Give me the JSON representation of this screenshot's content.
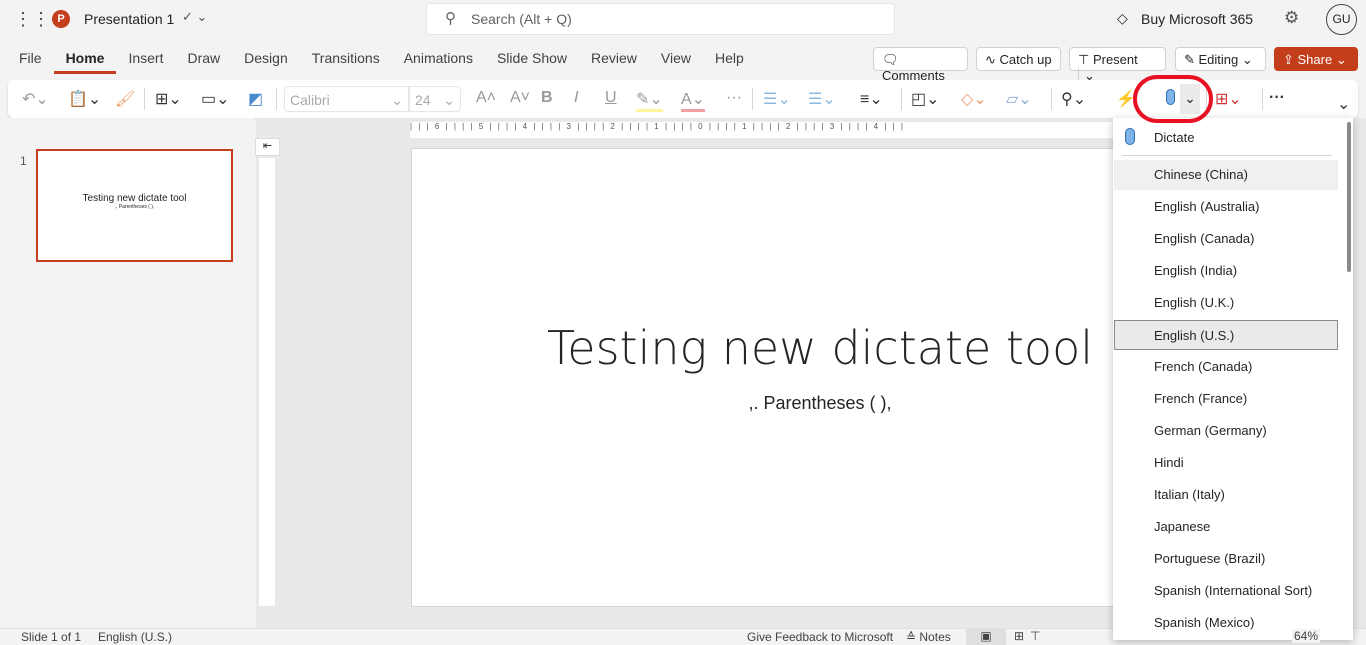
{
  "titlebar": {
    "app_title": "Presentation 1",
    "search_placeholder": "Search (Alt + Q)",
    "buy": "Buy Microsoft 365",
    "avatar": "GU"
  },
  "tabs": [
    {
      "label": "File"
    },
    {
      "label": "Home"
    },
    {
      "label": "Insert"
    },
    {
      "label": "Draw"
    },
    {
      "label": "Design"
    },
    {
      "label": "Transitions"
    },
    {
      "label": "Animations"
    },
    {
      "label": "Slide Show"
    },
    {
      "label": "Review"
    },
    {
      "label": "View"
    },
    {
      "label": "Help"
    }
  ],
  "actions": {
    "comments": "Comments",
    "catchup": "Catch up",
    "present": "Present",
    "editing": "Editing",
    "share": "Share"
  },
  "ribbon": {
    "font": "Calibri",
    "size": "24"
  },
  "ruler": {
    "h": "| | | 6 | | | | 5 | | | | 4 | | | | 3 | | | | 2 | | | | 1 | | | | 0 | | | | 1 | | | | 2 | | | | 3 | | | | 4 | | |"
  },
  "thumbnail": {
    "number": "1",
    "title": "Testing new dictate tool",
    "subtitle": ",. Parentheses ( ),"
  },
  "slide": {
    "title": "Testing new dictate tool",
    "subtitle": ",. Parentheses ( ),"
  },
  "dictate_menu": {
    "header": "Dictate",
    "items": [
      "Chinese (China)",
      "English (Australia)",
      "English (Canada)",
      "English (India)",
      "English (U.K.)",
      "English (U.S.)",
      "French (Canada)",
      "French (France)",
      "German (Germany)",
      "Hindi",
      "Italian (Italy)",
      "Japanese",
      "Portuguese (Brazil)",
      "Spanish (International Sort)",
      "Spanish (Mexico)"
    ],
    "hovered": "Chinese (China)",
    "selected": "English (U.S.)"
  },
  "status": {
    "slide": "Slide 1 of 1",
    "language": "English (U.S.)",
    "feedback": "Give Feedback to Microsoft",
    "notes": "Notes",
    "zoom": "64%"
  },
  "colors": {
    "accent": "#c43e1c",
    "highlight_ring": "#e81123"
  }
}
